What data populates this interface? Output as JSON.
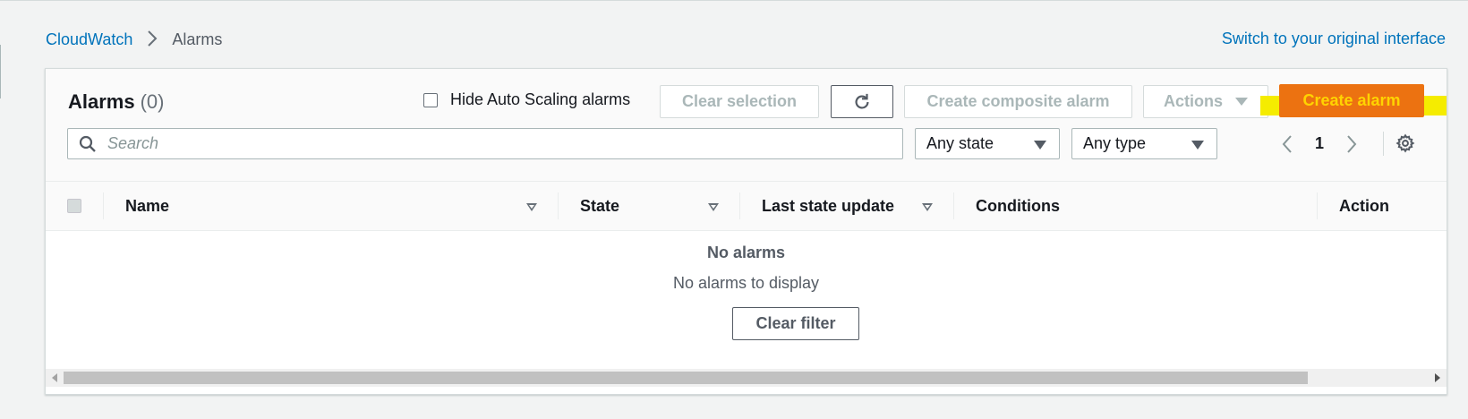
{
  "breadcrumb": {
    "root": "CloudWatch",
    "current": "Alarms"
  },
  "switch_link": "Switch to your original interface",
  "header": {
    "title": "Alarms",
    "count": "(0)",
    "hide_autoscaling_label": "Hide Auto Scaling alarms",
    "clear_selection": "Clear selection",
    "create_composite": "Create composite alarm",
    "actions": "Actions",
    "create_alarm": "Create alarm"
  },
  "search": {
    "placeholder": "Search"
  },
  "filters": {
    "state": "Any state",
    "type": "Any type"
  },
  "pagination": {
    "page": "1"
  },
  "table": {
    "columns": [
      "Name",
      "State",
      "Last state update",
      "Conditions",
      "Action"
    ]
  },
  "empty": {
    "title": "No alarms",
    "description": "No alarms to display",
    "clear_filter": "Clear filter"
  },
  "colors": {
    "accent": "#ec7211",
    "link": "#0073bb",
    "highlight": "#f5ec00"
  }
}
